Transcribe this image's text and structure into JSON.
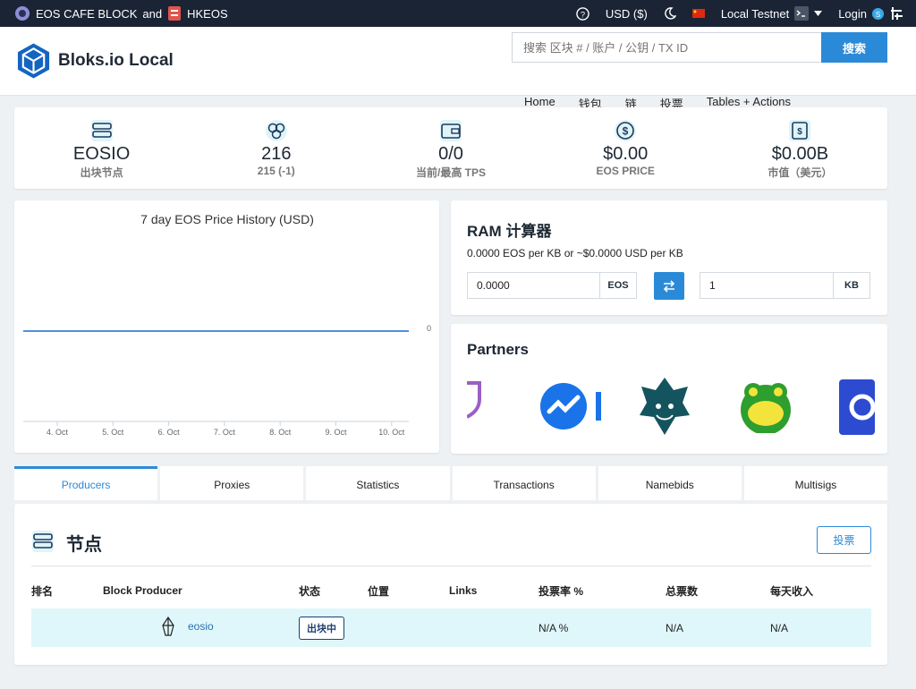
{
  "topbar": {
    "partner1": "EOS CAFE BLOCK",
    "and": "and",
    "partner2": "HKEOS",
    "currency": "USD ($)",
    "network": "Local Testnet",
    "login": "Login"
  },
  "header": {
    "logo": "Bloks.io Local",
    "search_placeholder": "搜索 区块 # / 账户 / 公钥 / TX ID",
    "search_button": "搜索",
    "nav": [
      "Home",
      "钱包",
      "链",
      "投票",
      "Tables + Actions"
    ]
  },
  "stats": [
    {
      "value": "EOSIO",
      "label": "出块节点",
      "icon": "server-icon"
    },
    {
      "value": "216",
      "label": "215 (-1)",
      "icon": "blocks-icon"
    },
    {
      "value": "0/0",
      "label": "当前/最高 TPS",
      "icon": "wallet-icon"
    },
    {
      "value": "$0.00",
      "label": "EOS PRICE",
      "icon": "dollar-icon"
    },
    {
      "value": "$0.00B",
      "label": "市值（美元）",
      "icon": "market-icon"
    }
  ],
  "chart_data": {
    "type": "line",
    "title": "7 day EOS Price History (USD)",
    "categories": [
      "4. Oct",
      "5. Oct",
      "6. Oct",
      "7. Oct",
      "8. Oct",
      "9. Oct",
      "10. Oct"
    ],
    "values": [
      0,
      0,
      0,
      0,
      0,
      0,
      0
    ],
    "y_tick": "0",
    "color": "#4a90d9"
  },
  "ram": {
    "title": "RAM 计算器",
    "rate": "0.0000 EOS per KB or ~$0.0000 USD per KB",
    "eos_value": "0.0000",
    "eos_unit": "EOS",
    "kb_value": "1",
    "kb_unit": "KB"
  },
  "partners": {
    "title": "Partners"
  },
  "tabs": [
    "Producers",
    "Proxies",
    "Statistics",
    "Transactions",
    "Namebids",
    "Multisigs"
  ],
  "producers": {
    "title": "节点",
    "vote_button": "投票",
    "columns": [
      "排名",
      "Block Producer",
      "状态",
      "位置",
      "Links",
      "投票率 %",
      "总票数",
      "每天收入"
    ],
    "rows": [
      {
        "rank": "",
        "name": "eosio",
        "status": "出块中",
        "location": "",
        "links": "",
        "vote_pct": "N/A %",
        "votes": "N/A",
        "daily": "N/A"
      }
    ]
  }
}
